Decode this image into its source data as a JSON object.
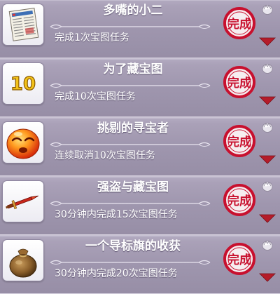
{
  "achievements": [
    {
      "title": "多嘴的小二",
      "description": "完成1次宝图任务",
      "icon": "newspaper-icon",
      "status": "完成"
    },
    {
      "title": "为了藏宝图",
      "description": "完成10次宝图任务",
      "icon": "number-10-icon",
      "status": "完成"
    },
    {
      "title": "挑剔的寻宝者",
      "description": "连续取消10次宝图任务",
      "icon": "angry-face-icon",
      "status": "完成"
    },
    {
      "title": "强盗与藏宝图",
      "description": "30分钟内完成15次宝图任务",
      "icon": "sword-icon",
      "status": "完成"
    },
    {
      "title": "一个导标旗的收获",
      "description": "30分钟内完成20次宝图任务",
      "icon": "money-bag-icon",
      "status": "完成"
    }
  ],
  "colors": {
    "row_background": "#a097b0",
    "seal_red": "#c8102e",
    "arrow_red": "#b51c2a",
    "text": "#ffffff"
  }
}
